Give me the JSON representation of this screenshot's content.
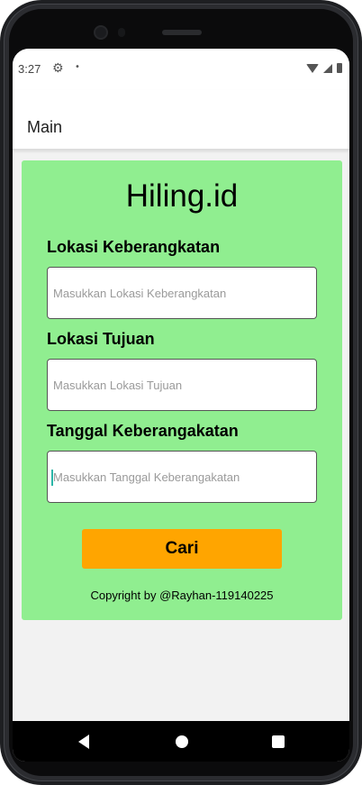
{
  "status_bar": {
    "time": "3:27",
    "settings_icon": "gear-icon",
    "notification_dot": "•"
  },
  "app_bar": {
    "title": "Main"
  },
  "form": {
    "brand": "Hiling.id",
    "departure": {
      "label": "Lokasi Keberangkatan",
      "placeholder": "Masukkan Lokasi Keberangkatan",
      "value": ""
    },
    "destination": {
      "label": "Lokasi Tujuan",
      "placeholder": "Masukkan Lokasi Tujuan",
      "value": ""
    },
    "date": {
      "label": "Tanggal Keberangakatan",
      "placeholder": "Masukkan Tanggal Keberangakatan",
      "value": ""
    },
    "search_button": "Cari",
    "copyright": "Copyright by @Rayhan-119140225"
  },
  "colors": {
    "card_background": "#90ee90",
    "button_background": "#ffa500",
    "cursor": "#2bb6a8"
  }
}
